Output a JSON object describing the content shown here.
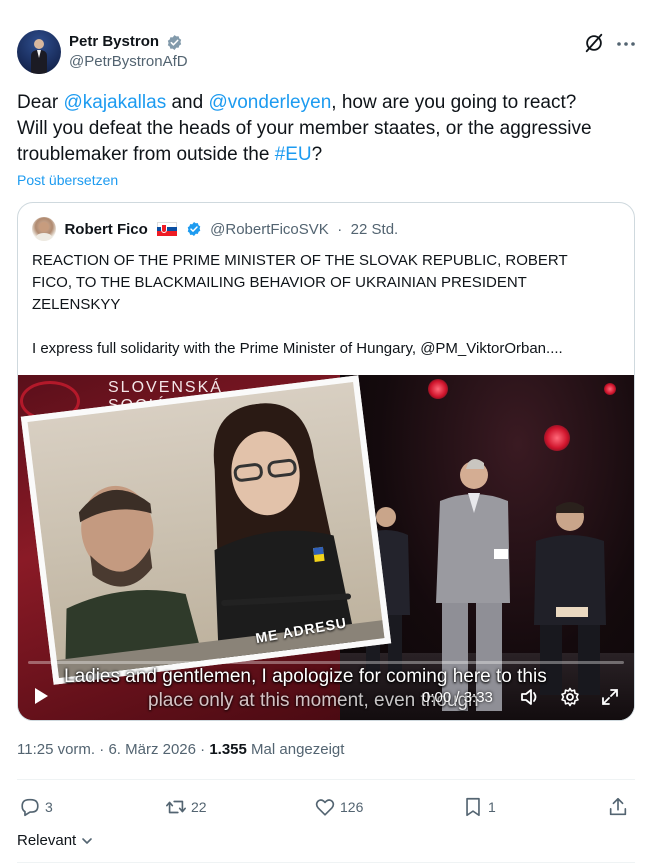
{
  "author": {
    "display_name": "Petr Bystron",
    "handle": "@PetrBystronAfD"
  },
  "tweet": {
    "line1_pre": "Dear ",
    "mention1": "@kajakallas",
    "line1_mid": " and ",
    "mention2": "@vonderleyen",
    "line1_post": ", how are you going to react?",
    "line2": "Will you defeat the heads of your member staates, or the aggressive",
    "line3_pre": "troublemaker from outside the ",
    "hashtag": "#EU",
    "line3_post": "?",
    "translate_label": "Post übersetzen"
  },
  "quote": {
    "display_name": "Robert Fico",
    "handle": "@RobertFicoSVK",
    "separator": "·",
    "time": "22 Std.",
    "body_line1": "REACTION OF THE PRIME MINISTER OF THE SLOVAK REPUBLIC, ROBERT",
    "body_line2": "FICO, TO THE BLACKMAILING BEHAVIOR OF UKRAINIAN PRESIDENT",
    "body_line3": "ZELENSKYY",
    "body_line4": "I express full solidarity with the Prime Minister of Hungary, @PM_ViktorOrban...."
  },
  "video": {
    "brand_line1": "SLOVENSKÁ",
    "brand_line2": "SOCIÁ",
    "inner_caption": "ME ADRESU",
    "subtitle_line1": "Ladies and gentlemen, I apologize for coming here to this",
    "subtitle_line2": "place only at this moment, even though",
    "time_display": "0:00 / 3:33",
    "progress": 0
  },
  "meta": {
    "time": "11:25 vorm.",
    "sep": "·",
    "date": "6. März 2026",
    "views_count": "1.355",
    "views_label": "Mal angezeigt"
  },
  "actions": {
    "replies": "3",
    "reposts": "22",
    "likes": "126",
    "bookmarks": "1"
  },
  "sort": {
    "label": "Relevant"
  },
  "colors": {
    "accent": "#1d9bf0",
    "muted": "#536471",
    "text": "#0f1419"
  }
}
